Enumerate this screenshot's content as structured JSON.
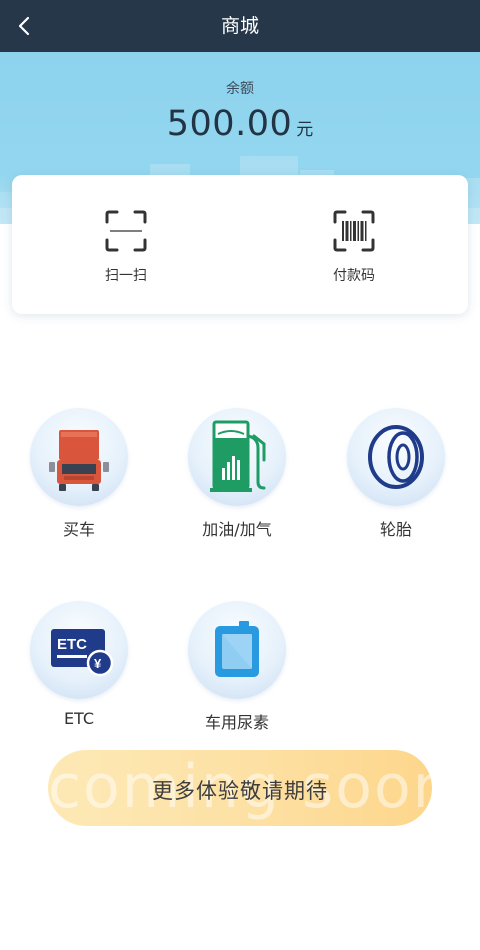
{
  "header": {
    "title": "商城"
  },
  "balance": {
    "label": "余额",
    "value": "500.00",
    "unit": "元"
  },
  "quick_actions": [
    {
      "label": "扫一扫",
      "icon": "scan-icon"
    },
    {
      "label": "付款码",
      "icon": "barcode-icon"
    }
  ],
  "services": [
    {
      "label": "买车",
      "icon": "truck-icon"
    },
    {
      "label": "加油/加气",
      "icon": "fuel-pump-icon"
    },
    {
      "label": "轮胎",
      "icon": "tire-icon"
    },
    {
      "label": "ETC",
      "icon": "etc-card-icon"
    },
    {
      "label": "车用尿素",
      "icon": "urea-container-icon"
    }
  ],
  "more_banner": {
    "watermark": "coming soon",
    "text": "更多体验敬请期待"
  },
  "colors": {
    "topbar": "#26374a",
    "hero": "#8dd3ee",
    "banner": "#fde0a3",
    "truck": "#d9553b",
    "fuel": "#1e9c64",
    "navy": "#1f3b8a",
    "urea": "#2a9ae0"
  }
}
